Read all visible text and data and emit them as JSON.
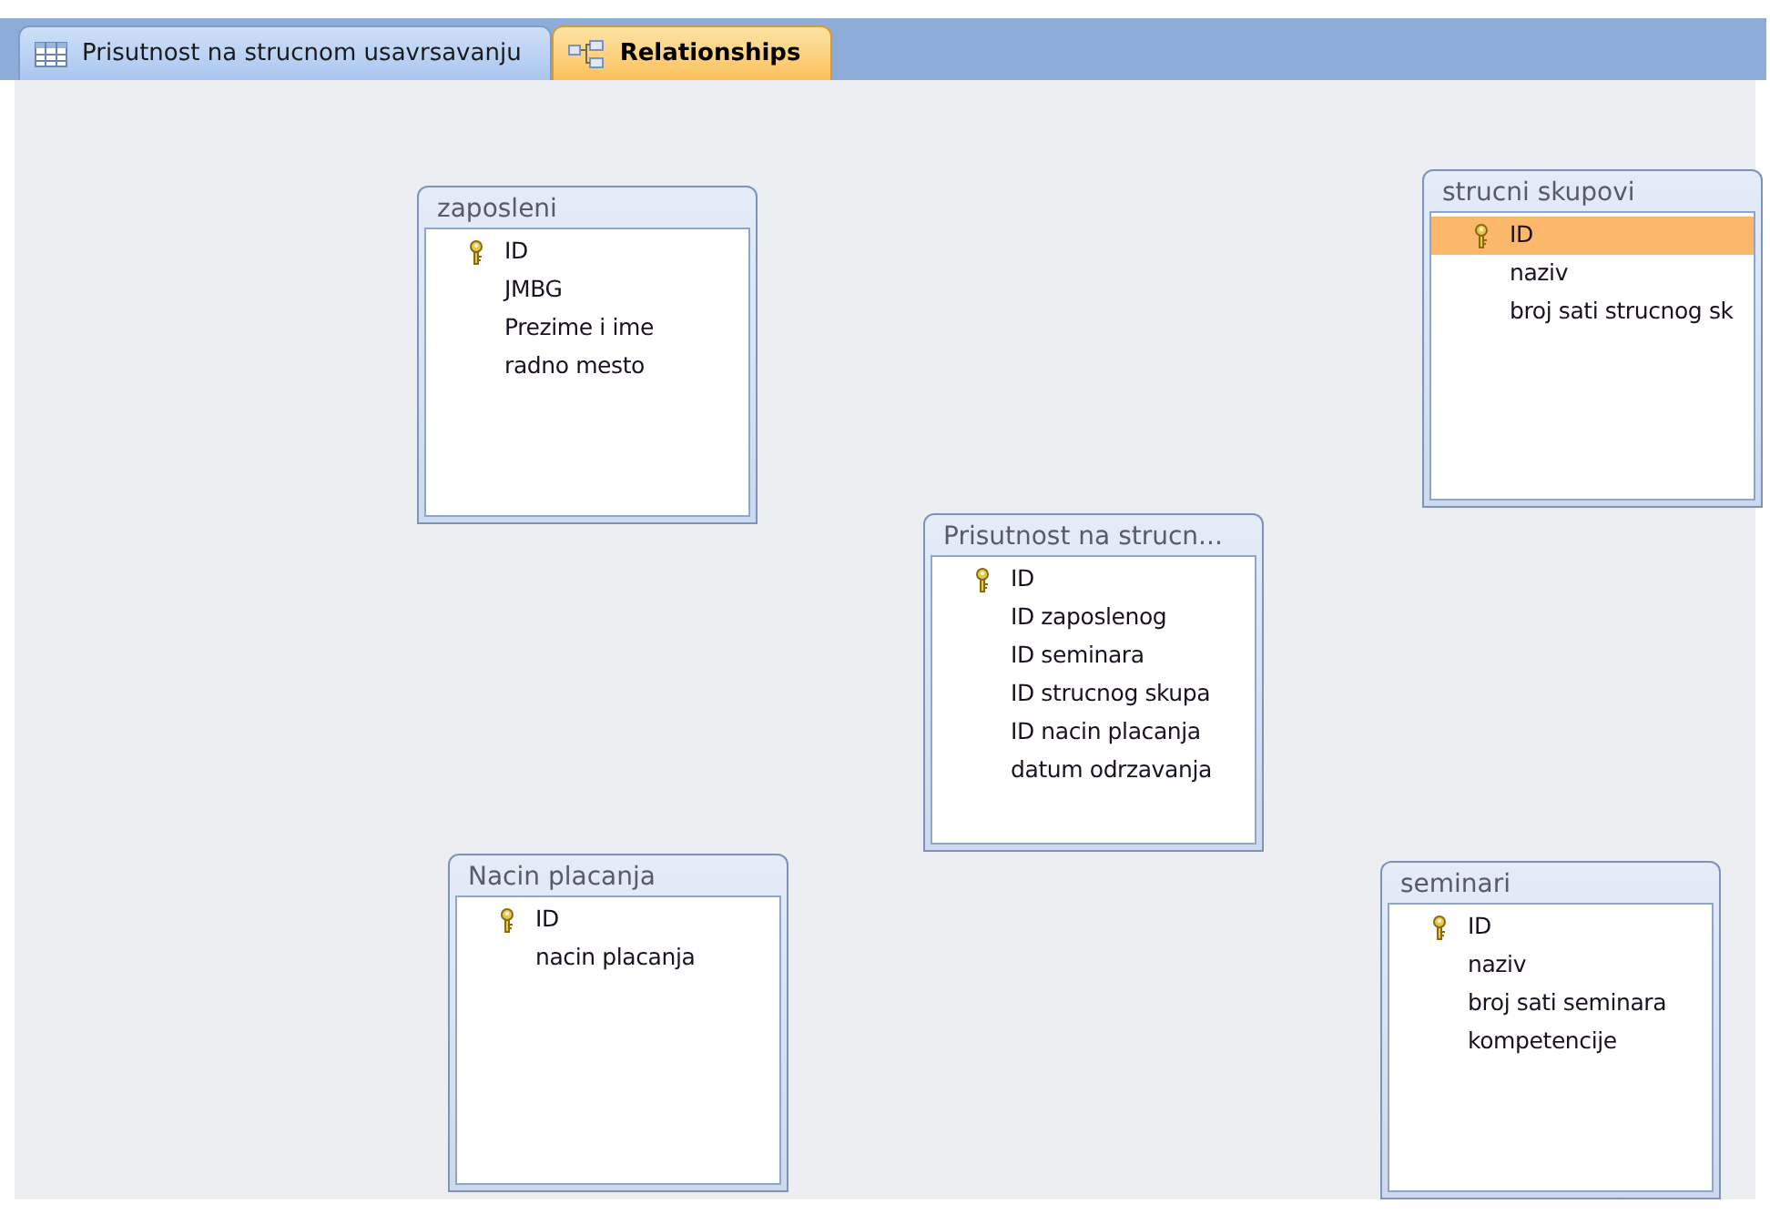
{
  "tabs": [
    {
      "label": "Prisutnost na strucnom usavrsavanju",
      "kind": "table",
      "selected": false
    },
    {
      "label": "Relationships",
      "kind": "relationships",
      "selected": true
    }
  ],
  "tables": [
    {
      "title": "zaposleni",
      "fields": [
        {
          "name": "ID",
          "key": true,
          "selected": false
        },
        {
          "name": "JMBG",
          "key": false,
          "selected": false
        },
        {
          "name": "Prezime i ime",
          "key": false,
          "selected": false
        },
        {
          "name": "radno mesto",
          "key": false,
          "selected": false
        }
      ]
    },
    {
      "title": "strucni skupovi",
      "fields": [
        {
          "name": "ID",
          "key": true,
          "selected": true
        },
        {
          "name": "naziv",
          "key": false,
          "selected": false
        },
        {
          "name": "broj sati strucnog sk",
          "key": false,
          "selected": false
        }
      ]
    },
    {
      "title": "Prisutnost na strucn...",
      "fields": [
        {
          "name": "ID",
          "key": true,
          "selected": false
        },
        {
          "name": "ID zaposlenog",
          "key": false,
          "selected": false
        },
        {
          "name": "ID seminara",
          "key": false,
          "selected": false
        },
        {
          "name": "ID strucnog skupa",
          "key": false,
          "selected": false
        },
        {
          "name": "ID nacin placanja",
          "key": false,
          "selected": false
        },
        {
          "name": "datum odrzavanja",
          "key": false,
          "selected": false
        }
      ]
    },
    {
      "title": "Nacin placanja",
      "fields": [
        {
          "name": "ID",
          "key": true,
          "selected": false
        },
        {
          "name": "nacin placanja",
          "key": false,
          "selected": false
        }
      ]
    },
    {
      "title": "seminari",
      "fields": [
        {
          "name": "ID",
          "key": true,
          "selected": false
        },
        {
          "name": "naziv",
          "key": false,
          "selected": false
        },
        {
          "name": "broj sati seminara",
          "key": false,
          "selected": false
        },
        {
          "name": "kompetencije",
          "key": false,
          "selected": false
        }
      ]
    }
  ]
}
